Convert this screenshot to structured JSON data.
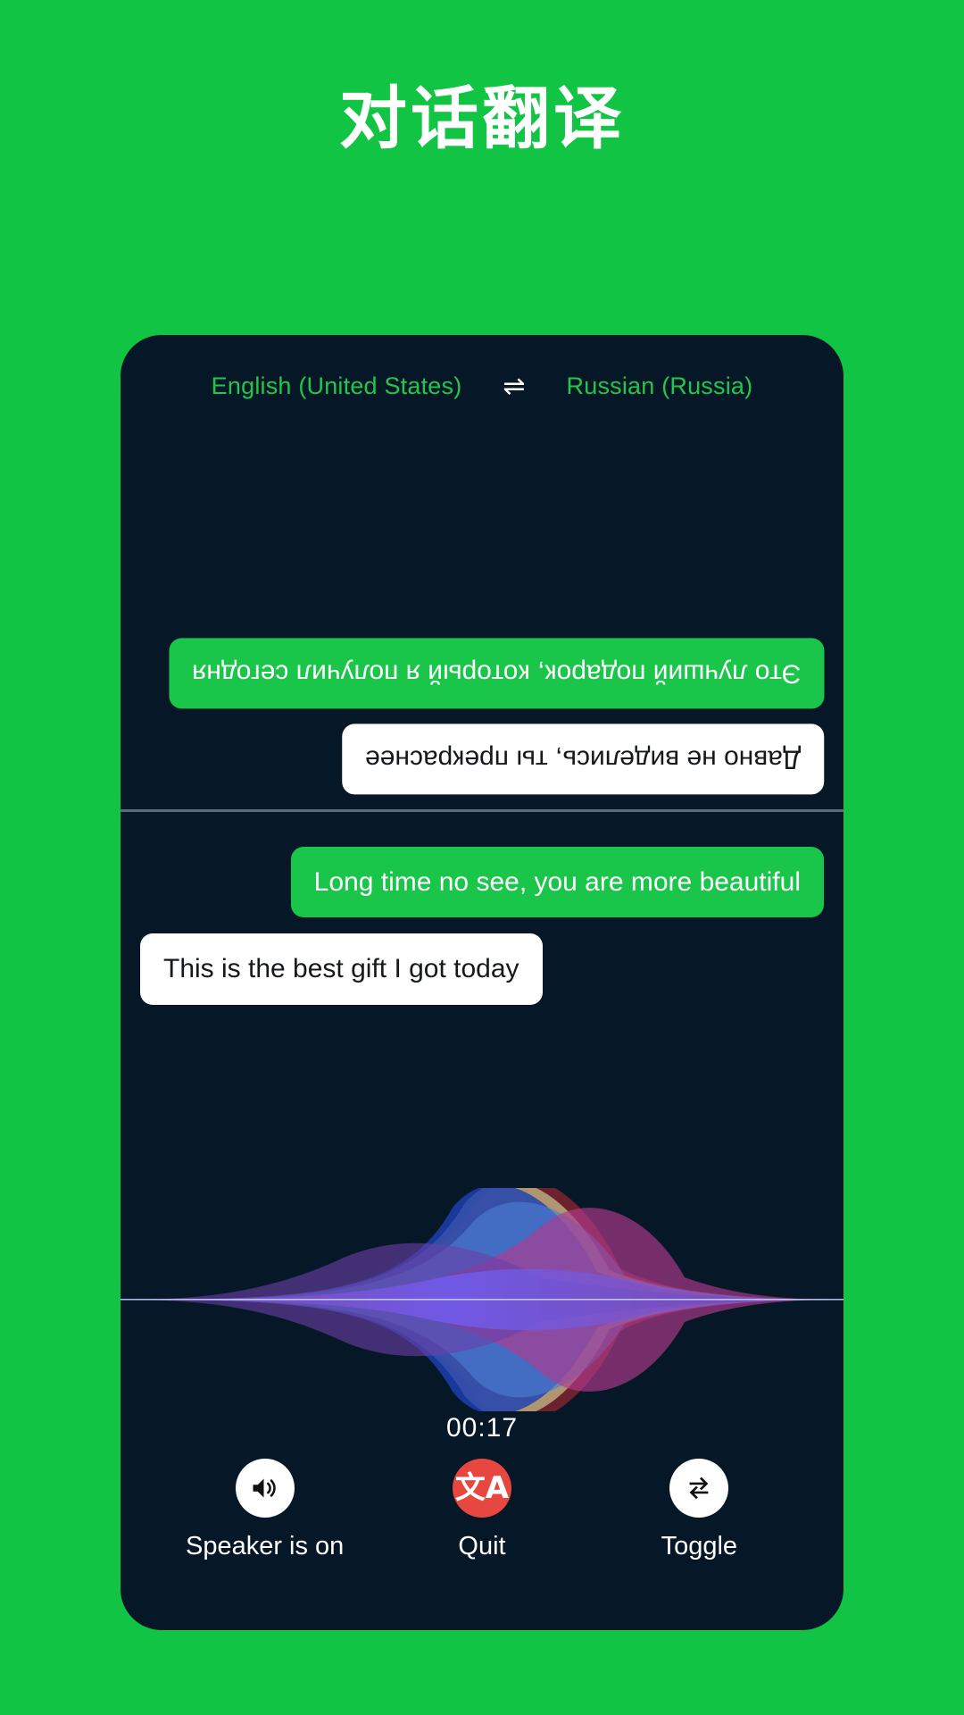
{
  "theme": {
    "background_green": "#11C444",
    "panel_dark": "#061827",
    "bubble_green": "#19C64A",
    "bubble_white": "#FFFFFF",
    "accent_red": "#E8473F",
    "lang_text_green": "#22C64A",
    "divider_gray": "#6B7A88"
  },
  "page": {
    "title": "对话翻译"
  },
  "language_bar": {
    "source_language": "English (United States)",
    "swap_icon": "swap-horizontal-icon",
    "swap_glyph": "⇌",
    "target_language": "Russian (Russia)"
  },
  "conversation": {
    "remote_side": {
      "description": "rotated-180-degrees translated view for the opposite speaker",
      "messages": [
        {
          "id": "remote-msg-1",
          "style": "green",
          "align": "right",
          "text": "Это лучший подарок, который я получил сегодня"
        },
        {
          "id": "remote-msg-2",
          "style": "white",
          "align": "right",
          "text": "Давно не виделись, ты прекраснее"
        }
      ]
    },
    "local_side": {
      "description": "upright view for the device holder",
      "messages": [
        {
          "id": "local-msg-1",
          "style": "green",
          "align": "right",
          "text": "Long time no see, you are more beautiful"
        },
        {
          "id": "local-msg-2",
          "style": "white",
          "align": "left",
          "text": "This is the best gift I got today"
        }
      ]
    }
  },
  "waveform": {
    "label": "audio-waveform-visualizer",
    "colors": [
      "#1d3fb4",
      "#4a7fd4",
      "#7b5cd6",
      "#6b3fa8",
      "#b03a8f",
      "#c9c48a",
      "#8b2230",
      "#5b7fd0"
    ]
  },
  "timer": {
    "elapsed": "00:17"
  },
  "controls": [
    {
      "id": "speaker",
      "icon": "speaker-on-icon",
      "circle_color": "#FFFFFF",
      "label": "Speaker is on"
    },
    {
      "id": "quit",
      "icon": "translate-icon",
      "glyph": "文A",
      "circle_color": "#E8473F",
      "label": "Quit"
    },
    {
      "id": "toggle",
      "icon": "repeat-swap-icon",
      "circle_color": "#FFFFFF",
      "label": "Toggle"
    }
  ]
}
